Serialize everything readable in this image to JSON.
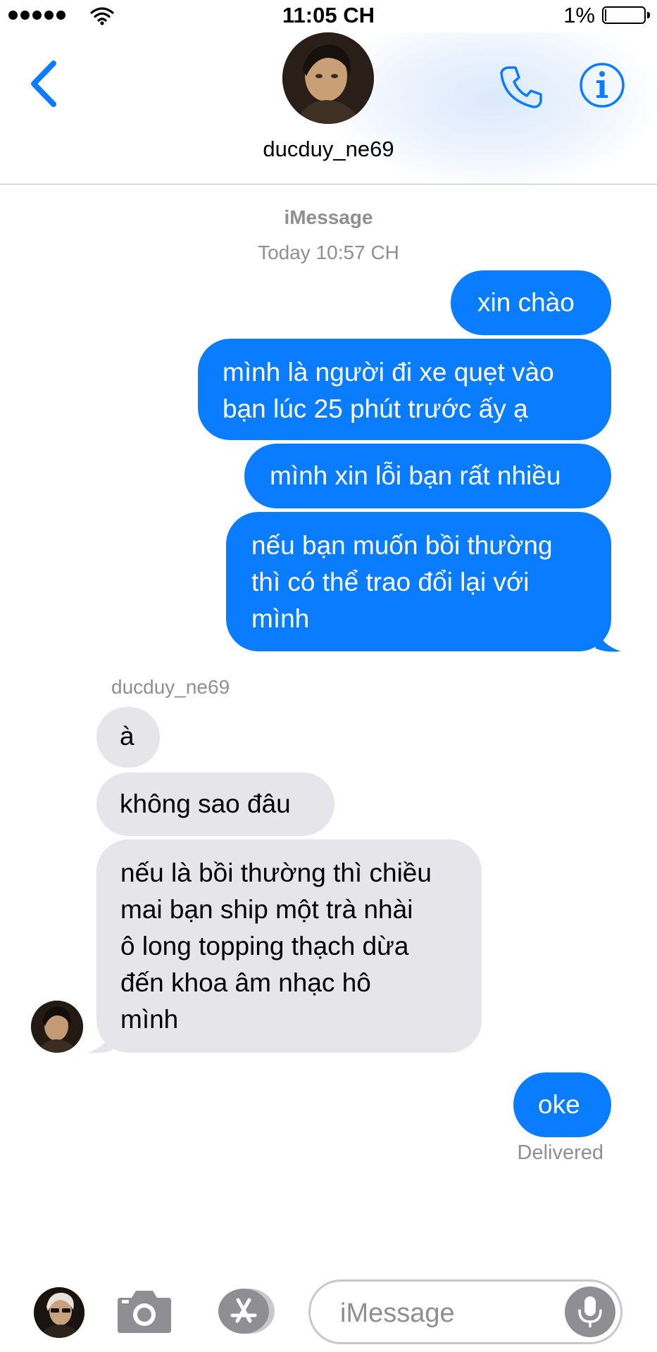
{
  "status_bar": {
    "time": "11:05 CH",
    "battery_percent": "1%",
    "battery_level": 0.01,
    "signal_bars": 5
  },
  "header": {
    "contact_name": "ducduy_ne69",
    "icons": [
      "chevron-left-icon",
      "phone-icon",
      "info-icon"
    ]
  },
  "conversation": {
    "service": "iMessage",
    "timestamp": "Today 10:57 CH",
    "outgoing_first": [
      {
        "lines": [
          "xin chào"
        ]
      },
      {
        "lines": [
          "mình là người đi xe quẹt vào",
          "bạn lúc 25 phút trước ấy ạ"
        ]
      },
      {
        "lines": [
          "mình xin lỗi bạn rất nhiều"
        ]
      },
      {
        "lines": [
          "nếu bạn muốn bồi thường",
          "thì có thể trao đổi lại với",
          "mình"
        ]
      }
    ],
    "sender_label": "ducduy_ne69",
    "incoming": [
      {
        "lines": [
          "à"
        ]
      },
      {
        "lines": [
          "không sao đâu"
        ]
      },
      {
        "lines": [
          "nếu là bồi thường thì chiều",
          "mai bạn ship một trà nhài",
          "ô long topping thạch dừa",
          "đến khoa âm nhạc hô",
          "mình"
        ]
      }
    ],
    "outgoing_last": {
      "lines": [
        "oke"
      ]
    },
    "delivery_status": "Delivered"
  },
  "input_bar": {
    "placeholder": "iMessage",
    "icons": [
      "camera-icon",
      "app-store-icon",
      "microphone-icon"
    ]
  },
  "colors": {
    "outgoing_bubble": "#0a7cff",
    "incoming_bubble": "#e5e5ea",
    "accent": "#0a7cff",
    "secondary_text": "#8e8e93"
  }
}
